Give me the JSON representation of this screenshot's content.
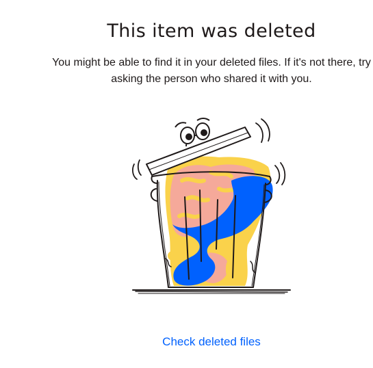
{
  "page": {
    "title": "This item was deleted",
    "message": "You might be able to find it in your deleted files. If it's not there, try asking the person who shared it with you.",
    "link_label": "Check deleted files"
  },
  "illustration": {
    "name": "trash-can-illustration",
    "colors": {
      "outline": "#1e1919",
      "pink": "#f5a99a",
      "yellow": "#fad24b",
      "blue": "#0061fe"
    }
  }
}
